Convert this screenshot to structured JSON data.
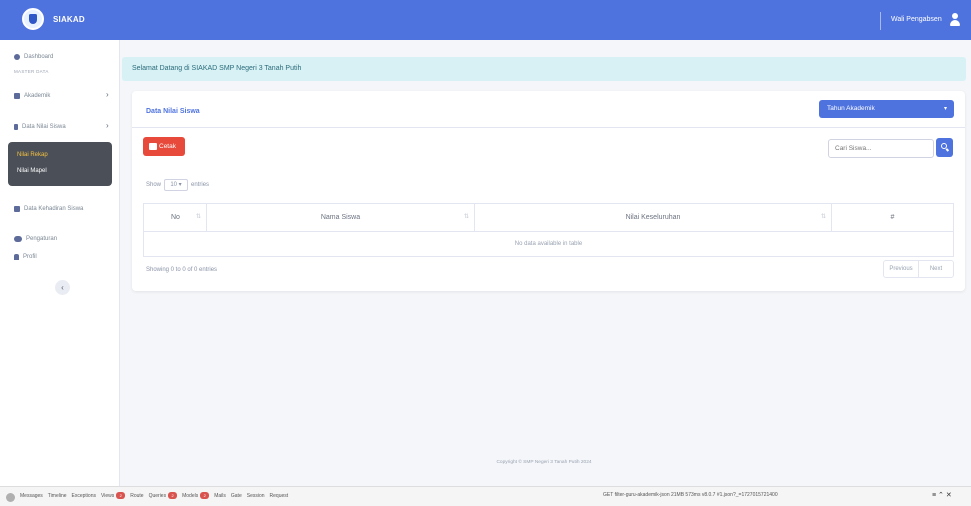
{
  "header": {
    "brand": "SIAKAD",
    "user": "Wali Pengabsen"
  },
  "sidebar": {
    "dashboard": "Dashboard",
    "heading": "MASTER DATA",
    "akademik": "Akademik",
    "nilai_group": "Data Nilai Siswa",
    "nilai_rekap": "Nilai Rekap",
    "nilai_mapel": "Nilai Mapel",
    "kehadiran": "Data Kehadiran Siswa",
    "pengaturan": "Pengaturan",
    "profil": "Profil",
    "collapse": "‹"
  },
  "welcome": "Selamat Datang di SIAKAD SMP Negeri 3 Tanah Putih",
  "card": {
    "title": "Data Nilai Siswa",
    "year_select": "Tahun Akademik",
    "print_label": "Cetak",
    "search_placeholder": "Cari Siswa...",
    "show_label": "Show",
    "entries_value": "10",
    "entries_label": "entries",
    "table": {
      "headers": [
        "No",
        "Nama Siswa",
        "Nilai Keseluruhan",
        "#"
      ],
      "empty": "No data available in table"
    },
    "info": "Showing 0 to 0 of 0 entries",
    "prev": "Previous",
    "next": "Next"
  },
  "footer": "Copyright © SMP Negeri 3 Tanah Putih 2024",
  "debugbar": {
    "tabs": [
      {
        "label": "Messages"
      },
      {
        "label": "Timeline"
      },
      {
        "label": "Exceptions"
      },
      {
        "label": "Views",
        "badge": "2"
      },
      {
        "label": "Route"
      },
      {
        "label": "Queries",
        "badge": "2"
      },
      {
        "label": "Models",
        "badge": "2"
      },
      {
        "label": "Mails"
      },
      {
        "label": "Gate"
      },
      {
        "label": "Session"
      },
      {
        "label": "Request"
      }
    ],
    "right_info": "GET filter-guru-akademik-json  21MB  573ms  v8.0.7  #1.json?_=1727015721400",
    "controls": "≡ ⌃ ✕"
  }
}
